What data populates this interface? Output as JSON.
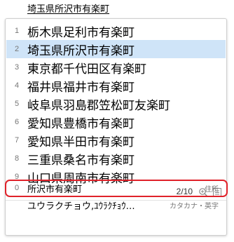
{
  "composition": {
    "text": "埼玉県所沢市有楽町"
  },
  "candidates": [
    {
      "number": "1",
      "text": "栃木県足利市有楽町"
    },
    {
      "number": "2",
      "text": "埼玉県所沢市有楽町"
    },
    {
      "number": "3",
      "text": "東京都千代田区有楽町"
    },
    {
      "number": "4",
      "text": "福井県福井市有楽町"
    },
    {
      "number": "5",
      "text": "岐阜県羽島郡笠松町友楽町"
    },
    {
      "number": "6",
      "text": "愛知県豊橋市有楽町"
    },
    {
      "number": "7",
      "text": "愛知県半田市有楽町"
    },
    {
      "number": "8",
      "text": "三重県桑名市有楽町"
    },
    {
      "number": "9",
      "text": "山口県周南市有楽町"
    }
  ],
  "footer": {
    "page_indicator": "2/10",
    "zoom_icon": "magnifier-icon",
    "list_icon": "list-icon"
  },
  "extra_candidates": [
    {
      "number": "0",
      "text": "所沢市有楽町",
      "tag": "住所"
    },
    {
      "number": "",
      "text": "ユウラクチョウ,ﾕｳﾗｸﾁｮｳ…",
      "tag": "カタカナ・英字"
    }
  ],
  "colors": {
    "selected_bg": "#cfe4f8",
    "highlight_ring": "#e0222a"
  }
}
